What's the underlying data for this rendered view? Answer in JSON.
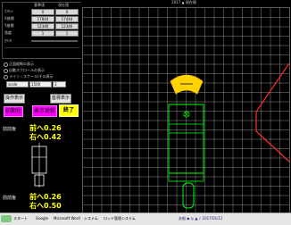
{
  "side_panel": {
    "header_left": "基準値",
    "header_right": "現在値",
    "params": [
      {
        "label": "ｵﾌｾｯﾄ",
        "value_a": "0",
        "value_b": "0"
      },
      {
        "label": "X座標",
        "value_a": "17844",
        "value_b": "17444"
      },
      {
        "label": "Y座標",
        "value_a": "12346",
        "value_b": "12346"
      },
      {
        "label": "角度",
        "value_a": "1",
        "value_b": "1"
      }
    ],
    "param_footer": "ｶｳﾝﾀ",
    "options": [
      "正面縦断の表示",
      "自動スクロールの表示",
      "ライン・スケール(その表示"
    ],
    "fields": [
      "scale",
      "1500",
      "3"
    ],
    "buttons": {
      "left": "操作表示",
      "right": "座標表示",
      "magenta_left": "初期化",
      "magenta_mid": "表示更新",
      "end": "終了"
    },
    "front_label": "前前後",
    "front_instruction_1": "前へ0.26",
    "front_instruction_2": "右へ0.42",
    "rear_label": "前前後",
    "rear_instruction_1": "前へ0.26",
    "rear_instruction_2": "右へ0.50"
  },
  "canvas": {
    "title": "2017 ▲ 現在値"
  },
  "colors": {
    "grid": "#c8c8c8",
    "vehicle": "#00ff00",
    "target": "#ffd400",
    "boundary": "#ff2d2d",
    "instruction": "#ffff00"
  },
  "taskbar": {
    "items": [
      "スタート",
      "Google",
      "Microsoft Word",
      "システム",
      "ロッド管理システム"
    ],
    "tray": "あ般 ◆ ◎ ▲ ♪ 2017/01/12"
  }
}
